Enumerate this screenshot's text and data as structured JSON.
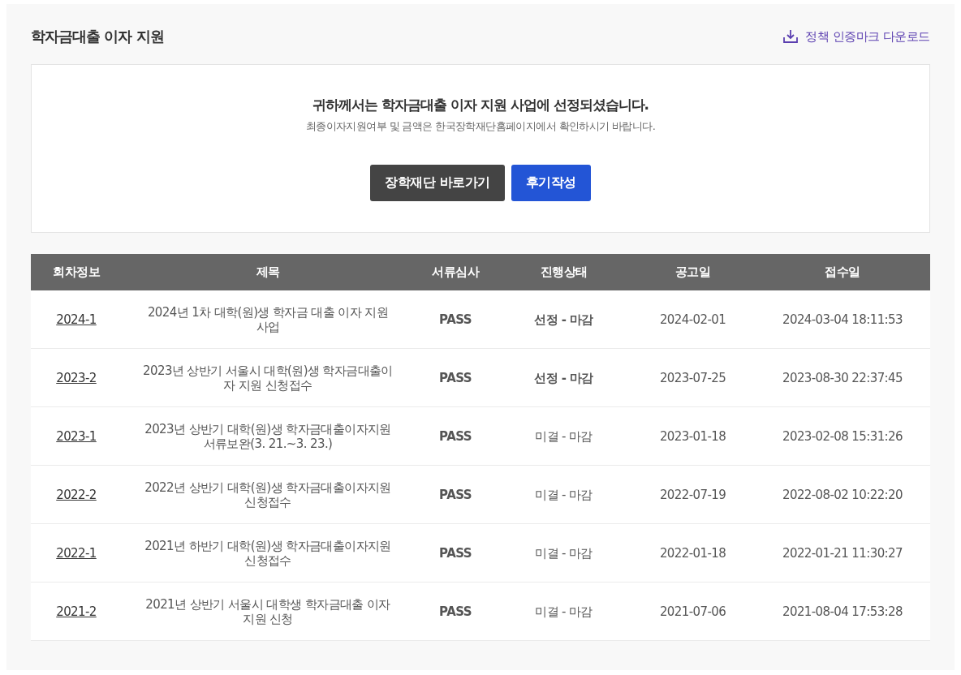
{
  "header": {
    "title": "학자금대출 이자 지원",
    "download_link": "정책 인증마크 다운로드"
  },
  "notice": {
    "headline": "귀하께서는 학자금대출 이자 지원 사업에 선정되셨습니다.",
    "subtext": "최종이자지원여부 및 금액은 한국장학재단홈페이지에서 확인하시기 바랍니다.",
    "buttons": [
      {
        "label": "장학재단 바로가기",
        "kind": "dark"
      },
      {
        "label": "후기작성",
        "kind": "primary"
      }
    ]
  },
  "table": {
    "columns": [
      "회차정보",
      "제목",
      "서류심사",
      "진행상태",
      "공고일",
      "접수일"
    ],
    "rows": [
      {
        "round": "2024-1",
        "title": "2024년 1차 대학(원)생 학자금 대출 이자 지원 사업",
        "review": "PASS",
        "status": "선정 - 마감",
        "kind": "selected",
        "notice_date": "2024-02-01",
        "received": "2024-03-04 18:11:53"
      },
      {
        "round": "2023-2",
        "title": "2023년 상반기 서울시 대학(원)생 학자금대출이자 지원 신청접수",
        "review": "PASS",
        "status": "선정 - 마감",
        "kind": "selected",
        "notice_date": "2023-07-25",
        "received": "2023-08-30 22:37:45"
      },
      {
        "round": "2023-1",
        "title": "2023년 상반기 대학(원)생 학자금대출이자지원 서류보완(3. 21.~3. 23.)",
        "review": "PASS",
        "status": "미결 - 마감",
        "kind": "pending",
        "notice_date": "2023-01-18",
        "received": "2023-02-08 15:31:26"
      },
      {
        "round": "2022-2",
        "title": "2022년 상반기 대학(원)생 학자금대출이자지원 신청접수",
        "review": "PASS",
        "status": "미결 - 마감",
        "kind": "pending",
        "notice_date": "2022-07-19",
        "received": "2022-08-02 10:22:20"
      },
      {
        "round": "2022-1",
        "title": "2021년 하반기 대학(원)생 학자금대출이자지원 신청접수",
        "review": "PASS",
        "status": "미결 - 마감",
        "kind": "pending",
        "notice_date": "2022-01-18",
        "received": "2022-01-21 11:30:27"
      },
      {
        "round": "2021-2",
        "title": "2021년 상반기 서울시 대학생 학자금대출 이자 지원 신청",
        "review": "PASS",
        "status": "미결 - 마감",
        "kind": "pending",
        "notice_date": "2021-07-06",
        "received": "2021-08-04 17:53:28"
      }
    ]
  }
}
